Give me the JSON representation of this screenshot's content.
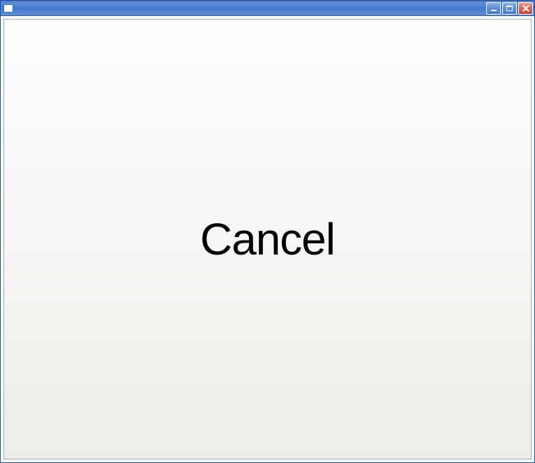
{
  "window": {
    "title": ""
  },
  "content": {
    "button_label": "Cancel"
  }
}
